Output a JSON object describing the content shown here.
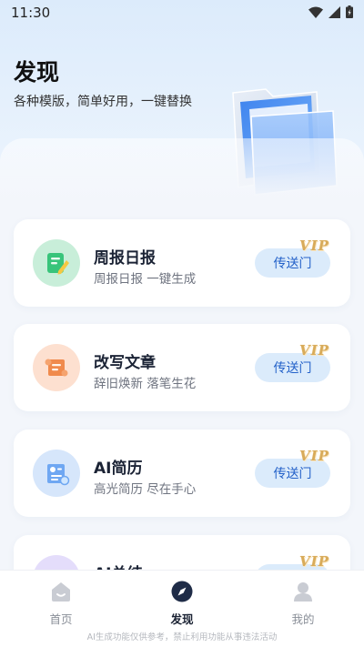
{
  "status_bar": {
    "time": "11:30"
  },
  "header": {
    "title": "发现",
    "subtitle": "各种模版，简单好用，一键替换"
  },
  "cards": [
    {
      "title": "周报日报",
      "desc": "周报日报 一键生成",
      "button": "传送门",
      "badge": "VIP",
      "icon": "document-pencil-icon",
      "icon_bg": "#c8eed9"
    },
    {
      "title": "改写文章",
      "desc": "辞旧焕新 落笔生花",
      "button": "传送门",
      "badge": "VIP",
      "icon": "scroll-icon",
      "icon_bg": "#fde0d0"
    },
    {
      "title": "AI简历",
      "desc": "高光简历 尽在手心",
      "button": "传送门",
      "badge": "VIP",
      "icon": "resume-icon",
      "icon_bg": "#d6e6fb"
    },
    {
      "title": "AI总结",
      "desc": "",
      "button": "传送门",
      "badge": "VIP",
      "icon": "summary-icon",
      "icon_bg": "#e4ddfb"
    }
  ],
  "tab_bar": {
    "tabs": [
      {
        "label": "首页",
        "icon": "home-icon",
        "active": false
      },
      {
        "label": "发现",
        "icon": "compass-icon",
        "active": true
      },
      {
        "label": "我的",
        "icon": "profile-icon",
        "active": false
      }
    ],
    "disclaimer": "AI生成功能仅供参考，禁止利用功能从事违法活动"
  },
  "colors": {
    "accent": "#2462c9",
    "button_bg": "#dbebfb",
    "vip_gold": "#d8ab5a"
  }
}
